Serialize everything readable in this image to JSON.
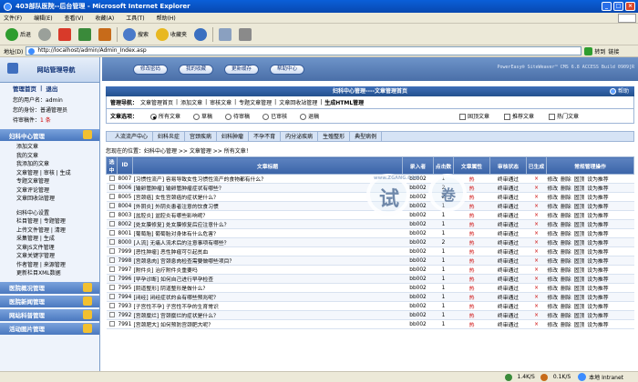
{
  "window": {
    "title": "403部队医院--后台管理 - Microsoft Internet Explorer",
    "buttons": [
      "_",
      "□",
      "×"
    ]
  },
  "menu": [
    "文件(F)",
    "编辑(E)",
    "查看(V)",
    "收藏(A)",
    "工具(T)",
    "帮助(H)"
  ],
  "toolbar": {
    "back": "后退",
    "search": "搜索",
    "favorites": "收藏夹"
  },
  "address": {
    "label": "地址(D)",
    "value": "http://localhost/admin/Admin_Index.asp",
    "go": "转到",
    "links": "链接"
  },
  "sidebar": {
    "header_title": "网站管理导航",
    "links": [
      "管理首页",
      "|",
      "退出"
    ],
    "info": [
      {
        "label": "您的用户名：",
        "value": "admin"
      },
      {
        "label": "您的身份：",
        "value": "普通管理员"
      },
      {
        "label": "待审稿件：",
        "value": "1 条"
      }
    ],
    "section_article": "妇科中心管理",
    "group1": [
      "添加文章",
      "我的文章",
      "我添加的文章",
      "文章管理 | 审核 | 生成",
      "专题文章管理",
      "文章评论管理",
      "文章回收站管理"
    ],
    "group2": [
      "妇科中心设置",
      "栏目管理 | 专题管理",
      "上传文件管理 | 清理",
      "采集管理 | 生成",
      "文章JS文件管理",
      "文章关键字管理",
      "作者管理 | 来源管理",
      "更新栏目XML数据"
    ],
    "sections_bottom": [
      "医院概况管理",
      "医院新闻管理",
      "网站科普管理",
      "活动图片管理"
    ]
  },
  "main": {
    "top_buttons": [
      "修改密码",
      "我的收藏",
      "更新缓存",
      "帮助中心"
    ],
    "powered": "PowerEasy® SiteWeaver™ CMS 6.8 ACCESS Build 0909[R",
    "title": "妇科中心管理----文章管理首页",
    "help": "帮助",
    "nav_label": "管理导航：",
    "nav_items": [
      "文章管理首页",
      "|",
      "添加文章",
      "|",
      "审核文章",
      "|",
      "专题文章管理",
      "|",
      "文章回收站管理",
      "|",
      "生成HTML管理"
    ],
    "option_label": "文章选项：",
    "radios": [
      "所有文章",
      "草稿",
      "待审稿",
      "已审核",
      "退稿"
    ],
    "checks": [
      "固顶文章",
      "推荐文章",
      "热门文章"
    ],
    "cat_tabs": [
      "人流流产中心",
      "妇科炎症",
      "宫颈疾病",
      "妇科肿瘤",
      "不孕不育",
      "内分泌疾病",
      "生殖整形",
      "典型病例"
    ],
    "location": "您现在的位置：妇科中心管理 >> 文章管理 >> 所有文章！",
    "columns": [
      "选中",
      "ID",
      "文章标题",
      "录入者",
      "点击数",
      "文章属性",
      "审核状态",
      "已生成",
      "常规管理操作"
    ],
    "rows": [
      {
        "id": "8007",
        "title": "[习惯性流产] 容易导致女性习惯性流产的食物都有什么？",
        "author": "bb002",
        "hits": "1",
        "attr": "热",
        "status": "终审通过",
        "gen": "×"
      },
      {
        "id": "8006",
        "title": "[输卵管肿瘤] 输卵管肿瘤症状有哪些？",
        "author": "bb002",
        "hits": "2",
        "attr": "热",
        "status": "终审通过",
        "gen": "×"
      },
      {
        "id": "8005",
        "title": "[宫颈癌] 女性宫颈癌的症状是什么？",
        "author": "bb002",
        "hits": "2",
        "attr": "热",
        "status": "终审通过",
        "gen": "×"
      },
      {
        "id": "8004",
        "title": "[外阴炎] 外阴炎患者注意的饮食习惯",
        "author": "bb002",
        "hits": "1",
        "attr": "热",
        "status": "终审通过",
        "gen": "×"
      },
      {
        "id": "8003",
        "title": "[盆腔炎] 盆腔炎有哪些影响呢？",
        "author": "bb002",
        "hits": "1",
        "attr": "热",
        "status": "终审通过",
        "gen": "×"
      },
      {
        "id": "8002",
        "title": "[处女膜修复] 处女膜修复后应注意什么？",
        "author": "bb002",
        "hits": "1",
        "attr": "热",
        "status": "终审通过",
        "gen": "×"
      },
      {
        "id": "8001",
        "title": "[葡萄胎] 葡萄胎对身体有什么危害？",
        "author": "bb002",
        "hits": "1",
        "attr": "热",
        "status": "终审通过",
        "gen": "×"
      },
      {
        "id": "8000",
        "title": "[人流] 无痛人流术后的注意事项有哪些？",
        "author": "bb002",
        "hits": "2",
        "attr": "热",
        "status": "终审通过",
        "gen": "×"
      },
      {
        "id": "7999",
        "title": "[恶性肿瘤] 恶性肿瘤可引起贫血",
        "author": "bb002",
        "hits": "1",
        "attr": "热",
        "status": "终审通过",
        "gen": "×"
      },
      {
        "id": "7998",
        "title": "[宫颈息肉] 宫颈息肉检查需要做哪些项目？",
        "author": "bb002",
        "hits": "1",
        "attr": "热",
        "status": "终审通过",
        "gen": "×"
      },
      {
        "id": "7997",
        "title": "[附件炎] 治疗附件炎重要吗",
        "author": "bb002",
        "hits": "1",
        "attr": "热",
        "status": "终审通过",
        "gen": "×"
      },
      {
        "id": "7996",
        "title": "[早孕诊断] 如何自己进行早孕检查",
        "author": "bb002",
        "hits": "1",
        "attr": "热",
        "status": "终审通过",
        "gen": "×"
      },
      {
        "id": "7995",
        "title": "[阴道整形] 阴道整形是做什么？",
        "author": "bb002",
        "hits": "1",
        "attr": "热",
        "status": "终审通过",
        "gen": "×"
      },
      {
        "id": "7994",
        "title": "[闭经] 闭经症状的会有哪些预兆呢？",
        "author": "bb002",
        "hits": "1",
        "attr": "热",
        "status": "终审通过",
        "gen": "×"
      },
      {
        "id": "7993",
        "title": "[子宫性不孕] 子宫性不孕的生育常识",
        "author": "bb002",
        "hits": "1",
        "attr": "热",
        "status": "终审通过",
        "gen": "×"
      },
      {
        "id": "7992",
        "title": "[宫颈糜烂] 宫颈糜烂的症状是什么？",
        "author": "bb002",
        "hits": "1",
        "attr": "热",
        "status": "终审通过",
        "gen": "×"
      },
      {
        "id": "7991",
        "title": "[宫颈肥大] 如何预防宫颈肥大呢？",
        "author": "bb002",
        "hits": "1",
        "attr": "热",
        "status": "终审通过",
        "gen": "×"
      }
    ],
    "ops": [
      "修改",
      "删除",
      "固顶",
      "设为推荐"
    ]
  },
  "watermark": {
    "text": "www.ZGANG.COM",
    "big": "试",
    "small": "卷"
  },
  "status": {
    "speed_down": "1.4K/S",
    "speed_up": "0.1K/S",
    "zone": "本地 Intranet"
  }
}
